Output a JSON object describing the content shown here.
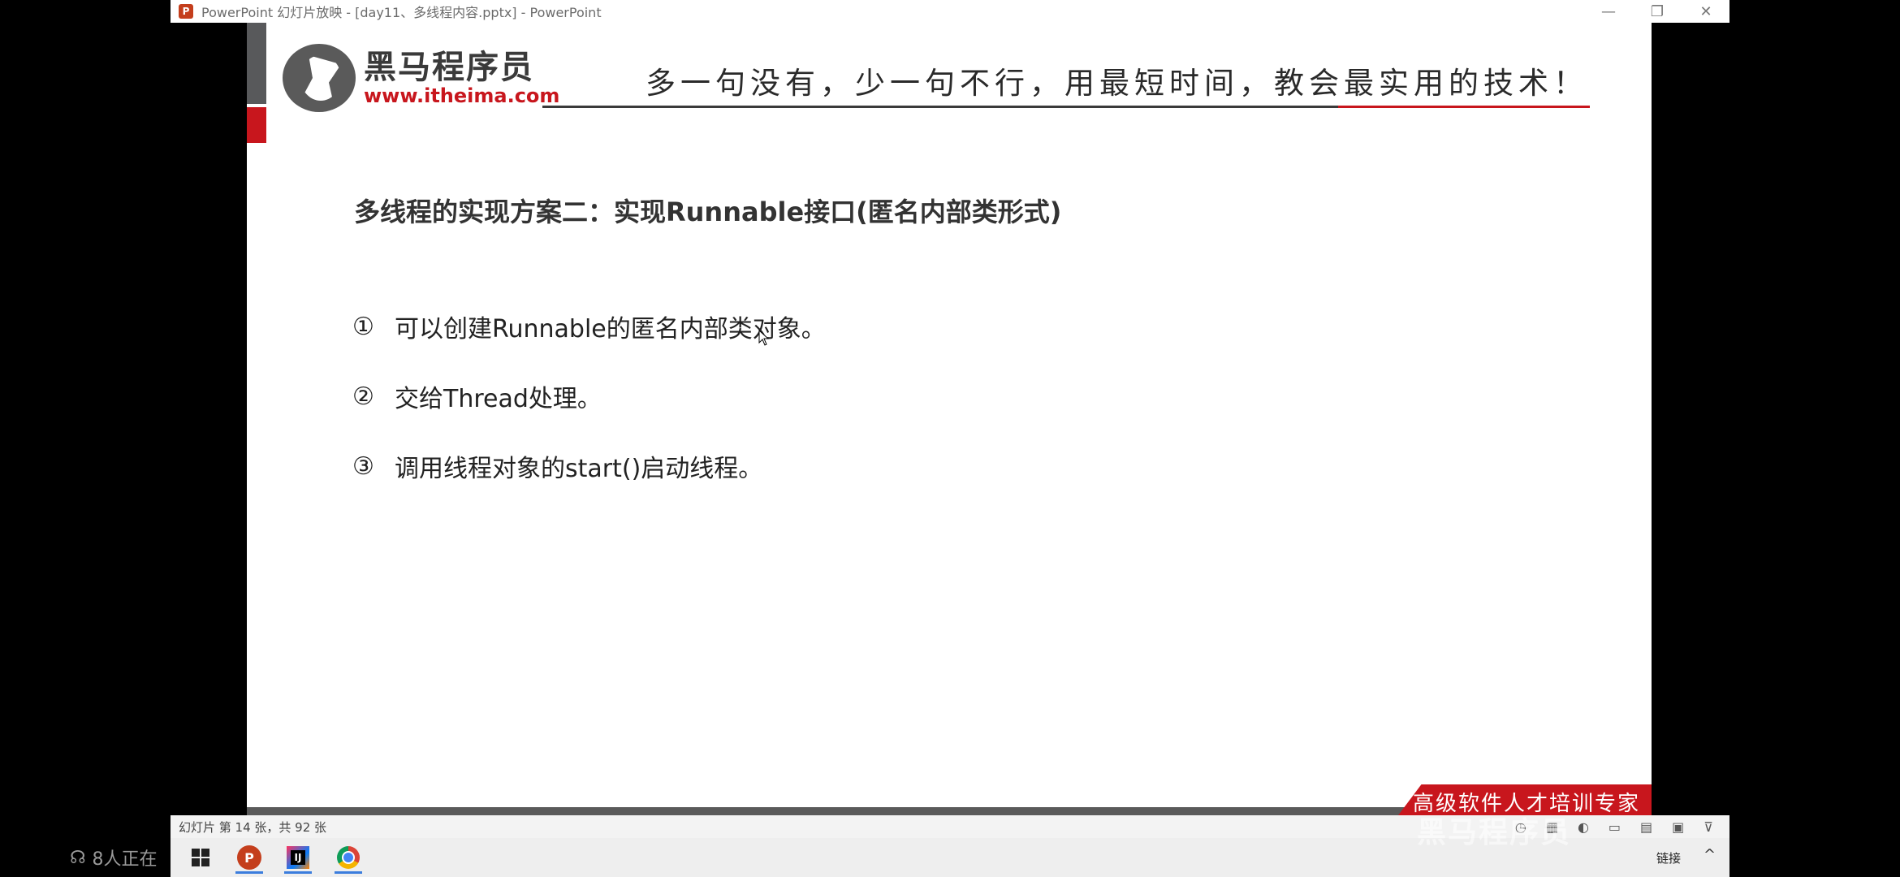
{
  "window": {
    "title": "PowerPoint 幻灯片放映 - [day11、多线程内容.pptx] - PowerPoint",
    "app_icon": "P",
    "min": "—",
    "max": "❐",
    "close": "✕"
  },
  "slide": {
    "logo_cn": "黑马程序员",
    "logo_url": "www.itheima.com",
    "slogan": "多一句没有，少一句不行，用最短时间，教会最实用的技术！",
    "heading": "多线程的实现方案二：实现Runnable接口(匿名内部类形式)",
    "points": [
      {
        "num": "①",
        "text": "可以创建Runnable的匿名内部类对象。"
      },
      {
        "num": "②",
        "text": "交给Thread处理。"
      },
      {
        "num": "③",
        "text": "调用线程对象的start()启动线程。"
      }
    ],
    "footer_badge": "高级软件人才培训专家"
  },
  "status_bar": {
    "text": "幻灯片 第 14 张，共 92 张",
    "icons": [
      "◷",
      "▦",
      "◐",
      "▭",
      "▤",
      "▣",
      "⊽"
    ]
  },
  "taskbar": {
    "ppt_label": "P",
    "idea_label": "IJ",
    "tray_text": "链接",
    "tray_chevron": "^"
  },
  "overlay": {
    "viewers": "8人正在",
    "watermark": "黑马程序员"
  }
}
